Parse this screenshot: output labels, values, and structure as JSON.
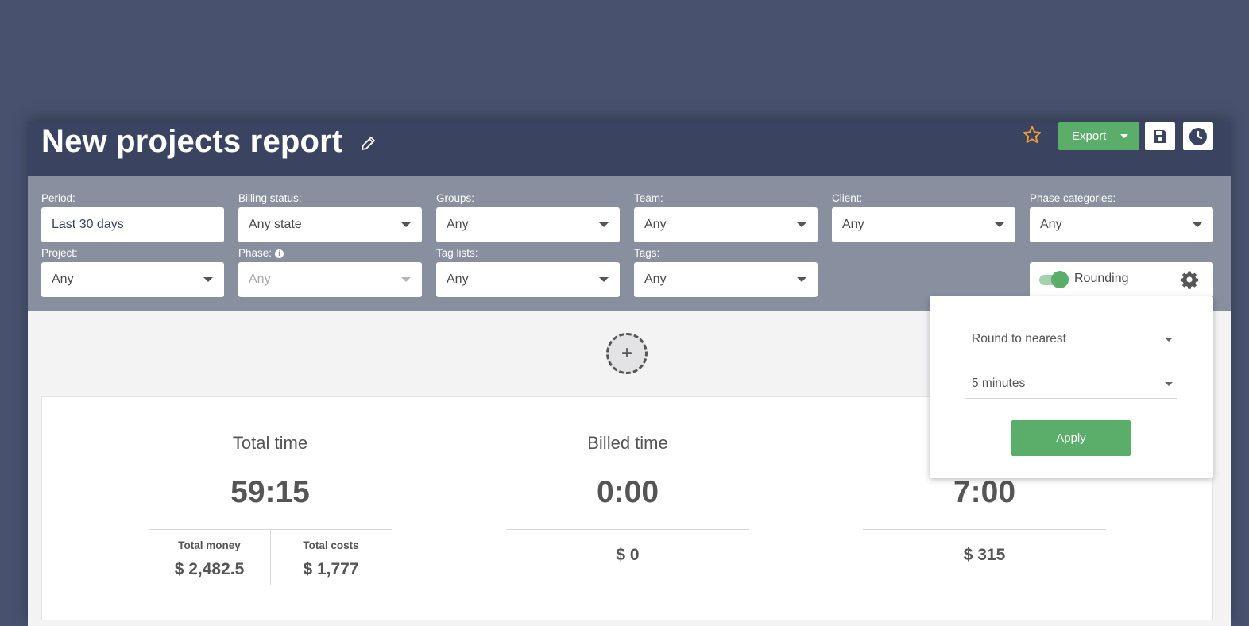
{
  "header": {
    "title": "New projects report",
    "export_label": "Export"
  },
  "filters": {
    "row1": [
      {
        "label": "Period:",
        "value": "Last 30 days"
      },
      {
        "label": "Billing status:",
        "value": "Any state"
      },
      {
        "label": "Groups:",
        "value": "Any"
      },
      {
        "label": "Team:",
        "value": "Any"
      },
      {
        "label": "Client:",
        "value": "Any"
      },
      {
        "label": "Phase categories:",
        "value": "Any"
      }
    ],
    "row2": [
      {
        "label": "Project:",
        "value": "Any"
      },
      {
        "label": "Phase:",
        "value": "Any"
      },
      {
        "label": "Tag lists:",
        "value": "Any"
      },
      {
        "label": "Tags:",
        "value": "Any"
      }
    ],
    "rounding": {
      "label": "Rounding",
      "enabled": true
    }
  },
  "popup": {
    "rounding_mode": "Round to nearest",
    "rounding_interval": "5 minutes",
    "apply_label": "Apply"
  },
  "summary": {
    "total": {
      "title": "Total time",
      "value": "59:15",
      "money_label": "Total money",
      "money_value": "$ 2,482.5",
      "costs_label": "Total costs",
      "costs_value": "$ 1,777"
    },
    "billed": {
      "title": "Billed time",
      "value": "0:00",
      "money": "$ 0"
    },
    "third": {
      "value": "7:00",
      "money": "$ 315"
    }
  },
  "colors": {
    "background": "#48526f",
    "header": "#3a4460",
    "filters": "#8890a0",
    "accent_green": "#5aae6a",
    "star": "#f0a030"
  },
  "icons": [
    "edit-icon",
    "star-icon",
    "save-icon",
    "clock-icon",
    "gear-icon",
    "info-icon",
    "plus-icon"
  ]
}
